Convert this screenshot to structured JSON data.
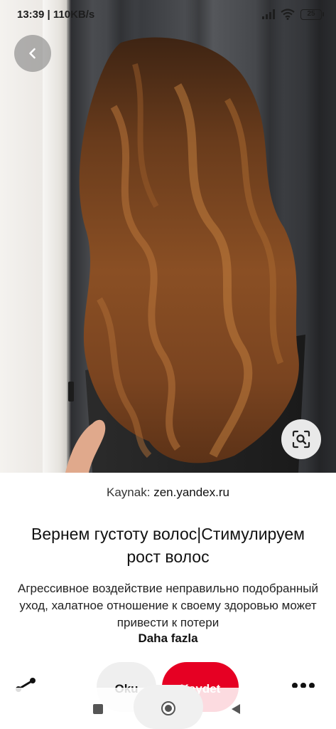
{
  "status_bar": {
    "time_speed": "13:39 | 110KB/s",
    "battery": "25"
  },
  "icons": {
    "back": "chevron-left-icon",
    "lens": "visual-search-icon",
    "share": "share-icon",
    "more": "more-horizontal-icon"
  },
  "pin": {
    "source_label": "Kaynak:",
    "source_domain": "zen.yandex.ru",
    "title": "Вернем густоту волос|Стимулируем рост волос",
    "description": "Агрессивное воздействие неправильно подобранный уход, халатное отношение к своему здоровью может привести к потери",
    "more_label": "Daha fazla"
  },
  "actions": {
    "read_label": "Oku",
    "save_label": "Kaydet"
  },
  "colors": {
    "save_button": "#e60023",
    "read_button": "#efefef"
  }
}
